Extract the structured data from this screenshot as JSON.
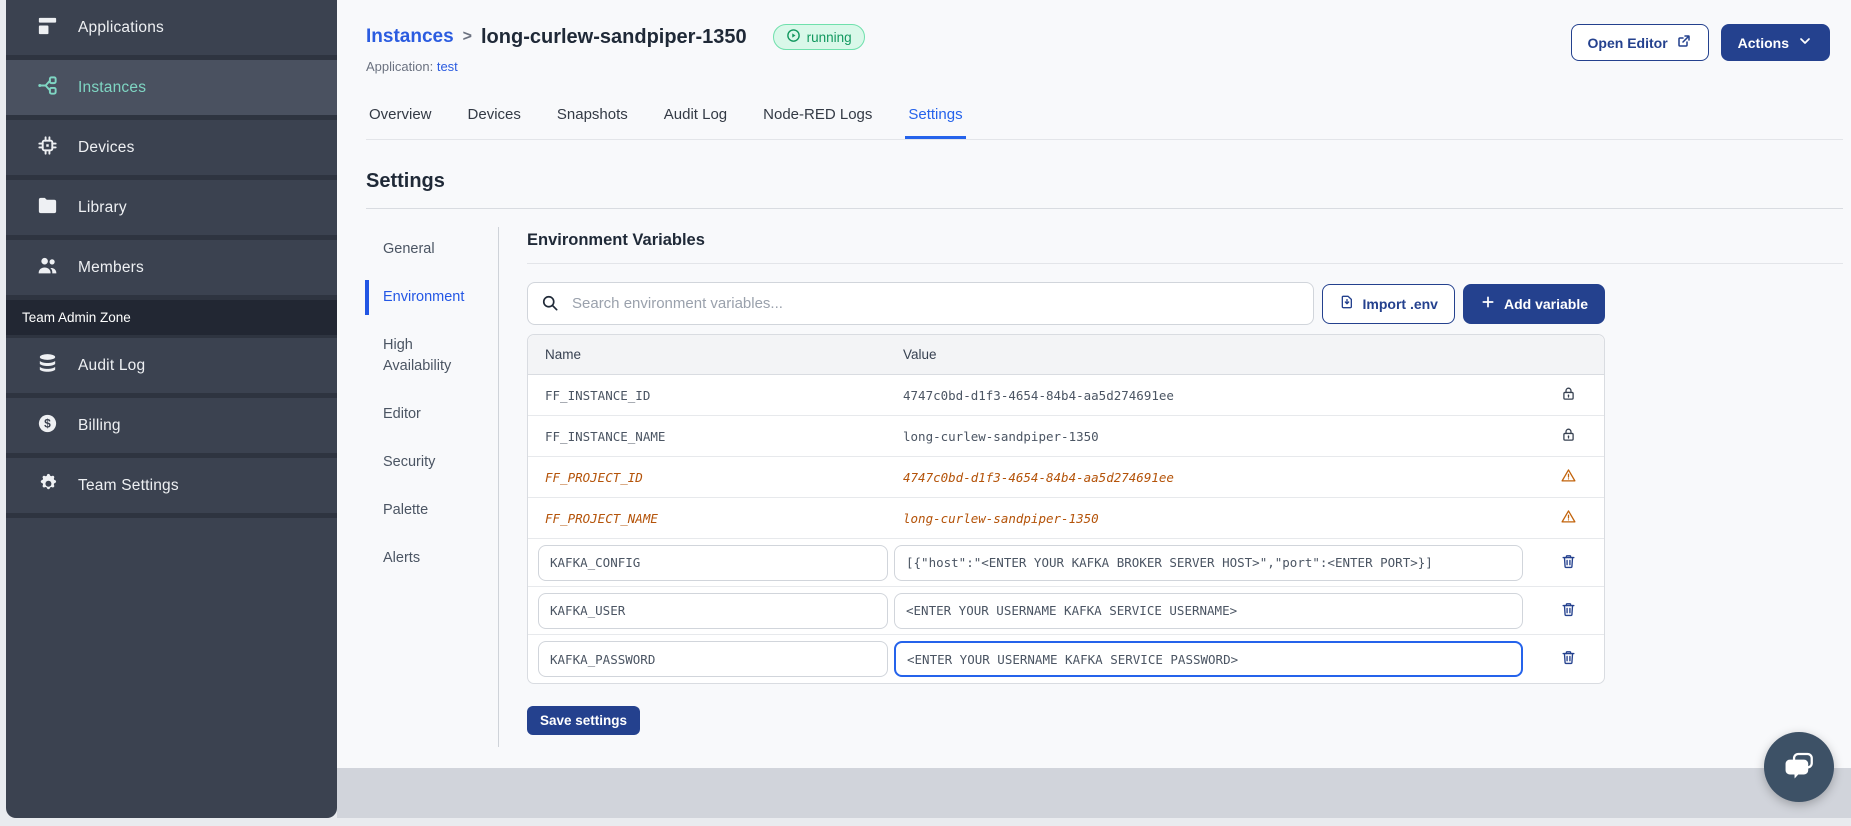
{
  "sidebar": {
    "items": [
      {
        "label": "Applications",
        "icon": "applications-icon",
        "active": false
      },
      {
        "label": "Instances",
        "icon": "instances-icon",
        "active": true
      },
      {
        "label": "Devices",
        "icon": "devices-icon",
        "active": false
      },
      {
        "label": "Library",
        "icon": "library-icon",
        "active": false
      },
      {
        "label": "Members",
        "icon": "members-icon",
        "active": false
      }
    ],
    "section_label": "Team Admin Zone",
    "admin_items": [
      {
        "label": "Audit Log",
        "icon": "audit-log-icon",
        "active": false
      },
      {
        "label": "Billing",
        "icon": "billing-icon",
        "active": false
      },
      {
        "label": "Team Settings",
        "icon": "team-settings-icon",
        "active": false
      }
    ]
  },
  "header": {
    "breadcrumb_root": "Instances",
    "breadcrumb_separator": ">",
    "instance_name": "long-curlew-sandpiper-1350",
    "status_badge": "running",
    "application_label": "Application:",
    "application_name": "test",
    "open_editor_label": "Open Editor",
    "actions_label": "Actions"
  },
  "tabs": [
    {
      "label": "Overview",
      "active": false
    },
    {
      "label": "Devices",
      "active": false
    },
    {
      "label": "Snapshots",
      "active": false
    },
    {
      "label": "Audit Log",
      "active": false
    },
    {
      "label": "Node-RED Logs",
      "active": false
    },
    {
      "label": "Settings",
      "active": true
    }
  ],
  "settings": {
    "title": "Settings",
    "nav": [
      {
        "label": "General",
        "active": false
      },
      {
        "label": "Environment",
        "active": true
      },
      {
        "label": "High Availability",
        "active": false
      },
      {
        "label": "Editor",
        "active": false
      },
      {
        "label": "Security",
        "active": false
      },
      {
        "label": "Palette",
        "active": false
      },
      {
        "label": "Alerts",
        "active": false
      }
    ],
    "panel": {
      "title": "Environment Variables",
      "search_placeholder": "Search environment variables...",
      "import_button": "Import .env",
      "add_button": "Add variable",
      "table": {
        "columns": [
          "Name",
          "Value"
        ],
        "rows": [
          {
            "name": "FF_INSTANCE_ID",
            "value": "4747c0bd-d1f3-4654-84b4-aa5d274691ee",
            "state": "locked"
          },
          {
            "name": "FF_INSTANCE_NAME",
            "value": "long-curlew-sandpiper-1350",
            "state": "locked"
          },
          {
            "name": "FF_PROJECT_ID",
            "value": "4747c0bd-d1f3-4654-84b4-aa5d274691ee",
            "state": "deprecated-warning"
          },
          {
            "name": "FF_PROJECT_NAME",
            "value": "long-curlew-sandpiper-1350",
            "state": "deprecated-warning"
          },
          {
            "name": "KAFKA_CONFIG",
            "value": "[{\"host\":\"<ENTER YOUR KAFKA BROKER SERVER HOST>\",\"port\":<ENTER PORT>}]",
            "state": "editable"
          },
          {
            "name": "KAFKA_USER",
            "value": "<ENTER YOUR USERNAME KAFKA SERVICE USERNAME>",
            "state": "editable"
          },
          {
            "name": "KAFKA_PASSWORD",
            "value": "<ENTER YOUR USERNAME KAFKA SERVICE PASSWORD>",
            "state": "editable-focused"
          }
        ]
      },
      "save_button": "Save settings"
    }
  },
  "colors": {
    "sidebar_bg": "#3b4250",
    "sidebar_active_bg": "#4a5160",
    "sidebar_active_text": "#7fd6c3",
    "brand_navy": "#24418e",
    "link_blue": "#2b5ce0",
    "tab_active_blue": "#2563eb",
    "status_green_text": "#12985f",
    "status_green_bg": "#d9f8e9",
    "warning_orange": "#b45309",
    "footer_gray": "#d1d4db"
  }
}
